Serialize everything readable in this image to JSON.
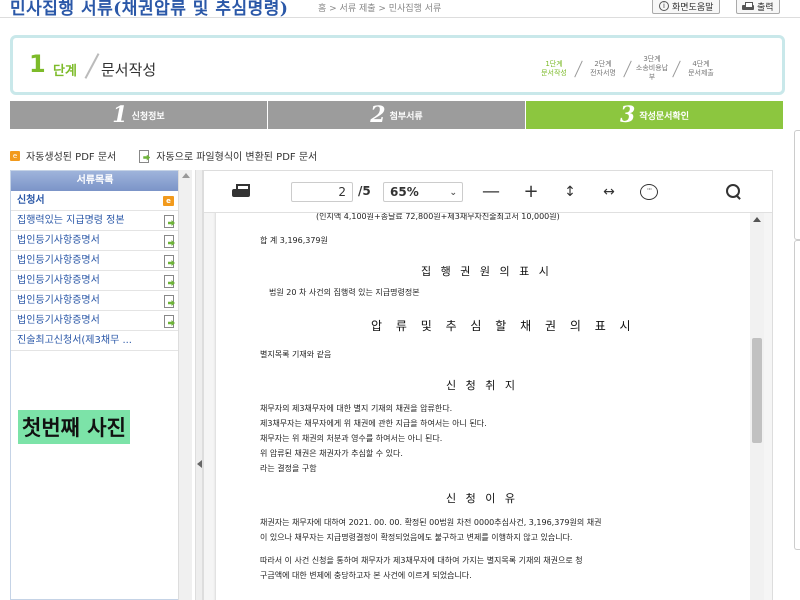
{
  "header": {
    "title": "민사집행 서류(채권압류 및 추심명령)",
    "breadcrumb": "홈 > 서류 제출 > 민사집행 서류",
    "help_label": "화면도움말",
    "print_label": "출력"
  },
  "step_box": {
    "number": "1",
    "word": "단계",
    "name": "문서작성",
    "steps": [
      {
        "top": "1단계",
        "bottom": "문서작성",
        "active": true
      },
      {
        "top": "2단계",
        "bottom": "전자서명",
        "active": false
      },
      {
        "top": "3단계",
        "bottom": "소송비용납부",
        "active": false
      },
      {
        "top": "4단계",
        "bottom": "문서제출",
        "active": false
      }
    ]
  },
  "progress": [
    {
      "n": "1",
      "label": "신청정보"
    },
    {
      "n": "2",
      "label": "첨부서류"
    },
    {
      "n": "3",
      "label": "작성문서확인"
    }
  ],
  "legend": {
    "auto_icon": "e",
    "auto_label": "자동생성된 PDF 문서",
    "converted_label": "자동으로 파일형식이 변환된 PDF 문서"
  },
  "doclist": {
    "header": "서류목록",
    "items": [
      {
        "label": "신청서",
        "icon": "e"
      },
      {
        "label": "집행력있는 지급명령 정본",
        "icon": "converted"
      },
      {
        "label": "법인등기사항증명서",
        "icon": "converted"
      },
      {
        "label": "법인등기사항증명서",
        "icon": "converted"
      },
      {
        "label": "법인등기사항증명서",
        "icon": "converted"
      },
      {
        "label": "법인등기사항증명서",
        "icon": "converted"
      },
      {
        "label": "법인등기사항증명서",
        "icon": "converted"
      },
      {
        "label": "진술최고신청서(제3채무 ...",
        "icon": ""
      }
    ],
    "overlay_label": "첫번째 사진"
  },
  "viewer": {
    "page_current": "2",
    "page_total": "/5",
    "zoom": "65%",
    "document": {
      "line_top": "(인지액 4,100원+송달료 72,800원+제3채무자진술최고서 10,000원)",
      "total": "합 계 3,196,379원",
      "h1": "집 행 권 원 의  표 시",
      "court_line": "법원 20  차      사건의 집행력 있는 지급명령정본",
      "h2": "압 류  및  추 심 할  채 권 의  표 시",
      "attach_line": "별지목록 기재와 같음",
      "h3": "신 청 취 지",
      "purpose": [
        "채무자의 제3채무자에 대한 별지 기재의 채권을 압류한다.",
        "제3채무자는 채무자에게 위 채권에 관한 지급을 하여서는 아니 된다.",
        "채무자는 위 채권의 처분과 영수를 하여서는 아니 된다.",
        "위 압류된 채권은 채권자가 추심할 수 있다.",
        "라는 결정을 구함"
      ],
      "h4": "신 청 이 유",
      "reason": [
        "채권자는 채무자에 대하여 2021. 00. 00. 확정된 00법원 차전 0000추심사건, 3,196,379원의 채권",
        "이 있으나 채무자는 지급명령결정이 확정되었음에도 불구하고 변제를 이행하지 않고 있습니다.",
        "따라서 이 사건 신청을 통하여 채무자가 제3채무자에 대하여 가지는 별지목록 기재의 채권으로 청",
        "구금액에 대한 변제에 충당하고자 본 사건에 이르게 되었습니다."
      ]
    }
  }
}
